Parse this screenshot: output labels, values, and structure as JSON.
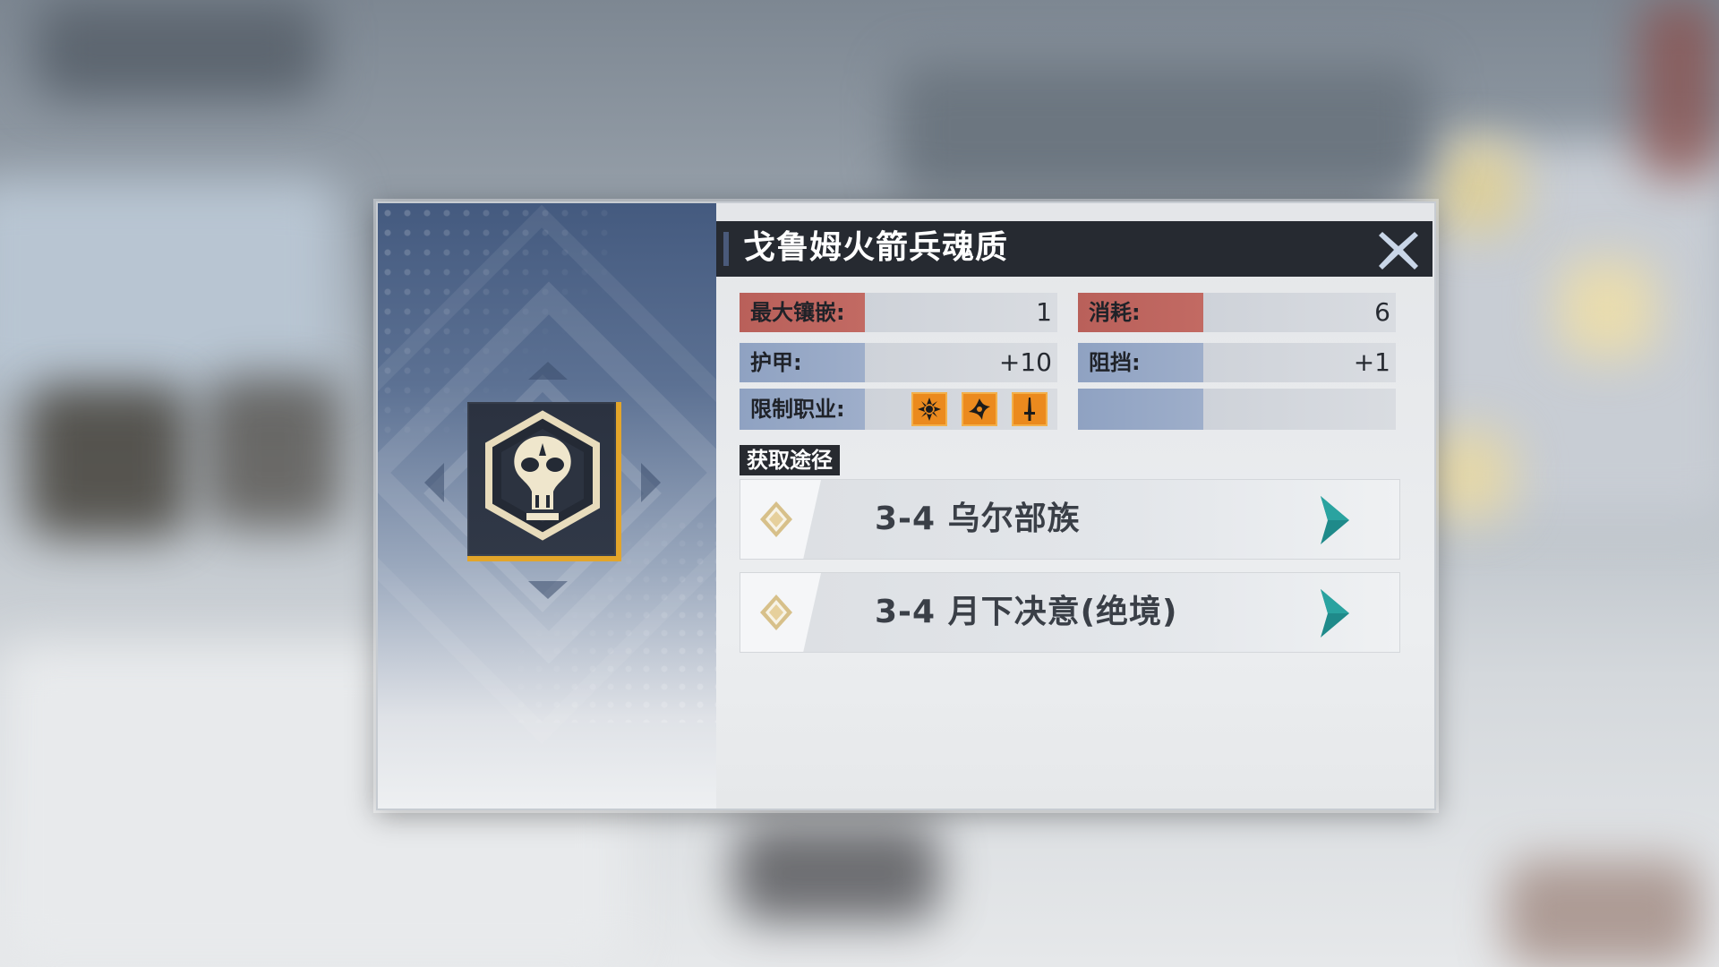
{
  "item": {
    "name": "戈鲁姆火箭兵魂质"
  },
  "stats": {
    "max_inlay": {
      "label": "最大镶嵌:",
      "value": "1"
    },
    "cost": {
      "label": "消耗:",
      "value": "6"
    },
    "armor": {
      "label": "护甲:",
      "value": "+10"
    },
    "block": {
      "label": "阻挡:",
      "value": "+1"
    },
    "class_limit": {
      "label": "限制职业:",
      "icons": [
        "flower-class-icon",
        "shuriken-class-icon",
        "sword-class-icon"
      ]
    }
  },
  "sources": {
    "tag": "获取途径",
    "routes": [
      {
        "label": "3-4 乌尔部族"
      },
      {
        "label": "3-4 月下决意(绝境)"
      }
    ]
  },
  "colors": {
    "accent_gold": "#e3a52a",
    "label_red": "#b9605a",
    "label_blue": "#8fa2c2",
    "class_orange": "#eb8a1e",
    "go_arrow_teal": "#1f8a8a"
  }
}
